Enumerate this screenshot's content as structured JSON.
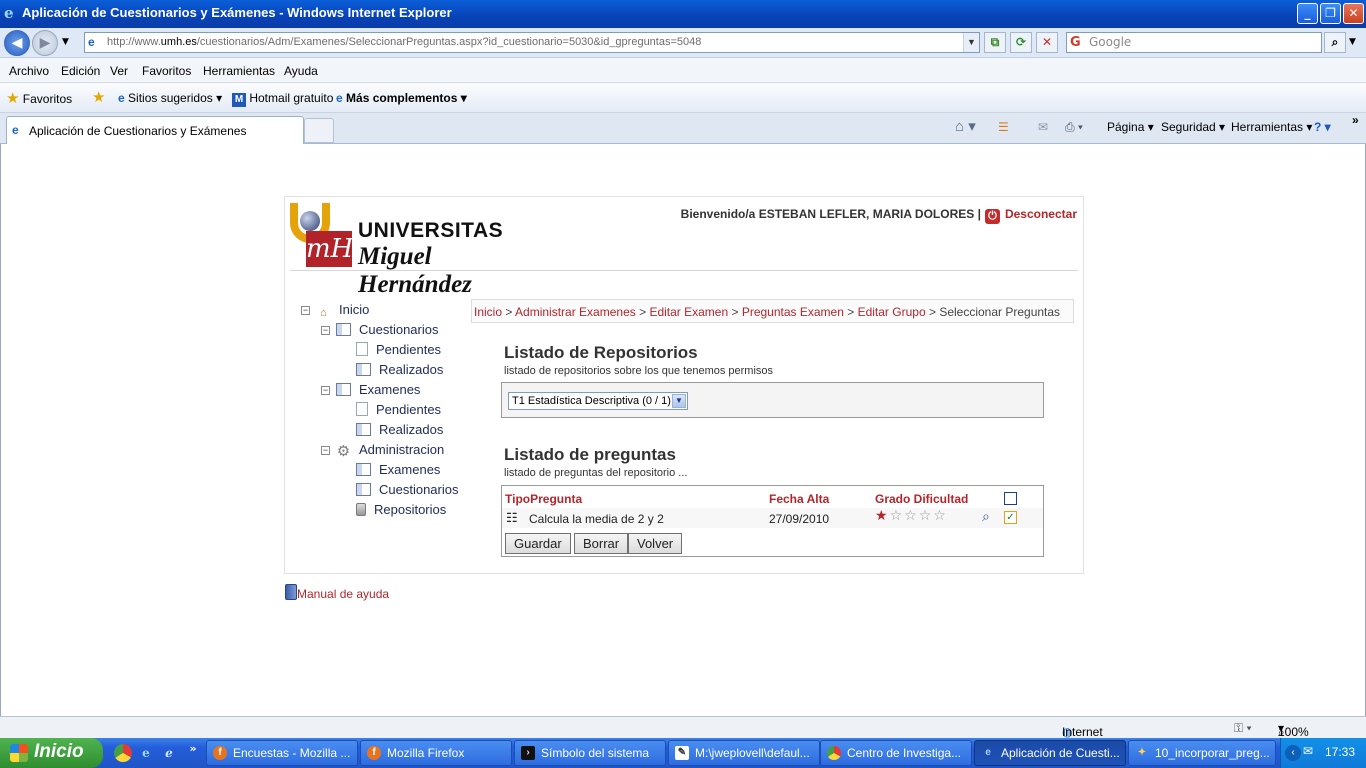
{
  "window": {
    "title": "Aplicación de Cuestionarios y Exámenes - Windows Internet Explorer"
  },
  "address": {
    "prefix": "http://www.",
    "host": "umh.es",
    "rest": "/cuestionarios/Adm/Examenes/SeleccionarPreguntas.aspx?id_cuestionario=5030&id_gpreguntas=5048"
  },
  "search": {
    "placeholder": "Google"
  },
  "menu": [
    "Archivo",
    "Edición",
    "Ver",
    "Favoritos",
    "Herramientas",
    "Ayuda"
  ],
  "favorites": {
    "label": "Favoritos",
    "suggested": "Sitios sugeridos",
    "hotmail": "Hotmail gratuito",
    "addons": "Más complementos"
  },
  "tab": {
    "title": "Aplicación de Cuestionarios y Exámenes"
  },
  "commandbar": {
    "page": "Página",
    "security": "Seguridad",
    "tools": "Herramientas"
  },
  "header": {
    "logo_line1": "UNIVERSITAS",
    "logo_line2": "Miguel Hernández",
    "welcome": "Bienvenido/a ESTEBAN LEFLER, MARIA DOLORES |",
    "logout": "Desconectar"
  },
  "tree": {
    "inicio": "Inicio",
    "cuestionarios": "Cuestionarios",
    "cuest_pendientes": "Pendientes",
    "cuest_realizados": "Realizados",
    "examenes": "Examenes",
    "exam_pendientes": "Pendientes",
    "exam_realizados": "Realizados",
    "administracion": "Administracion",
    "adm_examenes": "Examenes",
    "adm_cuestionarios": "Cuestionarios",
    "adm_repositorios": "Repositorios"
  },
  "breadcrumb": {
    "items": [
      "Inicio",
      "Administrar Examenes",
      "Editar Examen",
      "Preguntas Examen",
      "Editar Grupo"
    ],
    "current": "Seleccionar Preguntas",
    "separator": " > "
  },
  "repositories": {
    "title": "Listado de Repositorios",
    "subtitle": "listado de repositorios sobre los que tenemos permisos",
    "selected": "T1 Estadística Descriptiva (0 / 1)"
  },
  "questions": {
    "title": "Listado de preguntas",
    "subtitle": "listado de preguntas del repositorio ...",
    "columns": {
      "type": "TipoPregunta",
      "date": "Fecha Alta",
      "difficulty": "Grado Dificultad"
    },
    "rows": [
      {
        "text": "Calcula la media de 2 y 2",
        "date": "27/09/2010",
        "difficulty": 1,
        "difficulty_max": 5,
        "selected": true
      }
    ],
    "buttons": {
      "save": "Guardar",
      "delete": "Borrar",
      "back": "Volver"
    }
  },
  "help": "Manual de ayuda",
  "status": {
    "zone": "Internet",
    "zoom": "100%"
  },
  "taskbar": {
    "start": "Inicio",
    "tasks": [
      "Encuestas - Mozilla ...",
      "Mozilla Firefox",
      "Símbolo del sistema",
      "M:\\jweplovell\\defaul...",
      "Centro de Investiga...",
      "Aplicación de Cuesti...",
      "10_incorporar_preg..."
    ],
    "clock": "17:33"
  },
  "colors": {
    "accent": "#b3262b",
    "title_bar": "#0842b8",
    "taskbar": "#245edb"
  }
}
